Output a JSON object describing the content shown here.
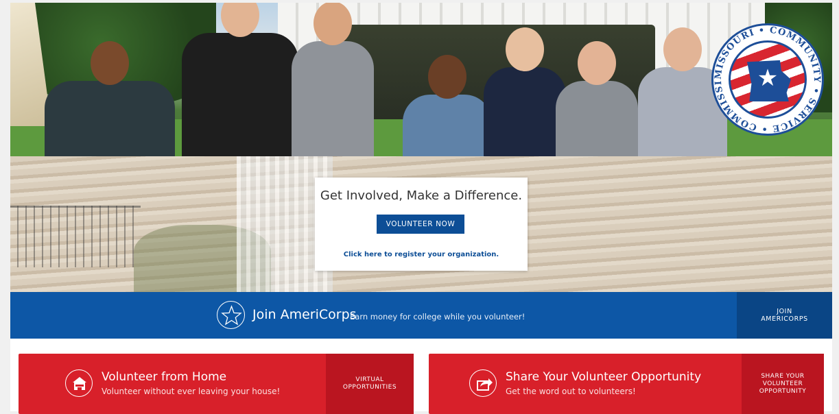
{
  "hero": {
    "logo_text": "MISSOURI • COMMUNITY • SERVICE • COMMISSION •",
    "logo_icon": "missouri-star-seal"
  },
  "cta": {
    "title": "Get Involved, Make a Difference.",
    "button_label": "VOLUNTEER NOW",
    "register_link": "Click here to register your organization."
  },
  "americorps": {
    "icon": "star-icon",
    "title": "Join AmeriCorps",
    "subtitle": "Earn money for college while you volunteer!",
    "button_line1": "JOIN",
    "button_line2": "AMERICORPS"
  },
  "cards": [
    {
      "icon": "house-icon",
      "title": "Volunteer from Home",
      "subtitle": "Volunteer without ever leaving your house!",
      "button_line1": "VIRTUAL",
      "button_line2": "OPPORTUNITIES"
    },
    {
      "icon": "share-icon",
      "title": "Share Your Volunteer Opportunity",
      "subtitle": "Get the word out to volunteers!",
      "button_line1": "SHARE YOUR",
      "button_line2": "VOLUNTEER",
      "button_line3": "OPPORTUNITY"
    }
  ],
  "colors": {
    "brand_blue": "#0d57a6",
    "dark_blue": "#0a4585",
    "brand_red": "#d8202a",
    "dark_red": "#ba1520"
  }
}
